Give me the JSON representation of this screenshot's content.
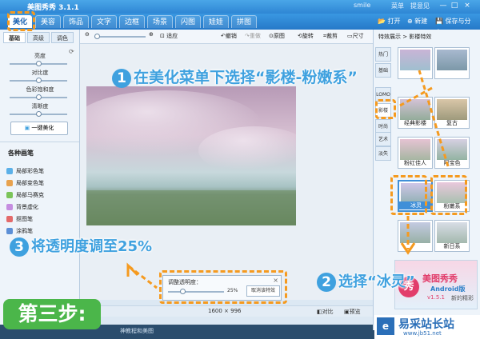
{
  "titlebar": {
    "title": "美图秀秀 3.1.1",
    "user": "smile",
    "menu": "菜单",
    "feedback": "提意见",
    "buttons": {
      "min": "—",
      "max": "□",
      "close": "×"
    }
  },
  "menubar": {
    "tabs": [
      "美化",
      "美容",
      "饰品",
      "文字",
      "边框",
      "场景",
      "闪图",
      "娃娃",
      "拼图"
    ],
    "open": "打开",
    "new": "新建",
    "save": "保存与分享"
  },
  "leftpanel": {
    "tabs": [
      "基础",
      "高级",
      "调色"
    ],
    "sliders": [
      {
        "label": "亮度",
        "value": 0.5
      },
      {
        "label": "对比度",
        "value": 0.5
      },
      {
        "label": "色彩饱和度",
        "value": 0.5
      },
      {
        "label": "清晰度",
        "value": 0.5
      }
    ],
    "one_click": "一键美化",
    "brushes_title": "各种画笔",
    "brushes": [
      "局部彩色笔",
      "局部变色笔",
      "局部马赛克",
      "背景虚化",
      "抠图笔",
      "涂鸦笔"
    ]
  },
  "toolbar": {
    "fit": "适应",
    "undo": "撤销",
    "redo": "重做",
    "original": "原图",
    "rotate": "旋转",
    "crop": "裁剪",
    "size": "尺寸"
  },
  "statusbar": {
    "dimensions": "1600 × 996",
    "compare": "对比",
    "preview": "预览"
  },
  "bottombar": {
    "text": "神教程和美图"
  },
  "opacity_dialog": {
    "label": "调整透明度：",
    "value_text": "25%",
    "value": 0.25,
    "cancel": "取消该特效"
  },
  "rightpanel": {
    "header": "特效展示 > 影楼特效",
    "vtabs": [
      "热门",
      "基础",
      "LOMO",
      "影楼",
      "时尚",
      "艺术",
      "淡失"
    ],
    "thumbs": [
      {
        "label": ""
      },
      {
        "label": ""
      },
      {
        "label": "经典影楼"
      },
      {
        "label": "复古"
      },
      {
        "label": "粉红佳人"
      },
      {
        "label": "阿宝色"
      },
      {
        "label": "冰灵"
      },
      {
        "label": "粉嫩系"
      },
      {
        "label": ""
      },
      {
        "label": "新日系"
      }
    ],
    "ad_text": "美图秀秀",
    "ad_sub": "Android版",
    "ad_version": "v1.5.1",
    "ad_slogan": "新的精彩"
  },
  "annotations": {
    "step1_num": "1",
    "step1": "在美化菜单下选择“影楼-粉嫩系”",
    "step2_num": "2",
    "step2": "选择“冰灵”",
    "step3_num": "3",
    "step3": "将透明度调至25%",
    "step_badge": "第三步:"
  },
  "watermark": {
    "text": "易采站长站",
    "url": "www.jb51.net"
  },
  "colors": {
    "accent": "#3fa1df",
    "highlight": "#f59a1f",
    "badge": "#4bb64a"
  }
}
